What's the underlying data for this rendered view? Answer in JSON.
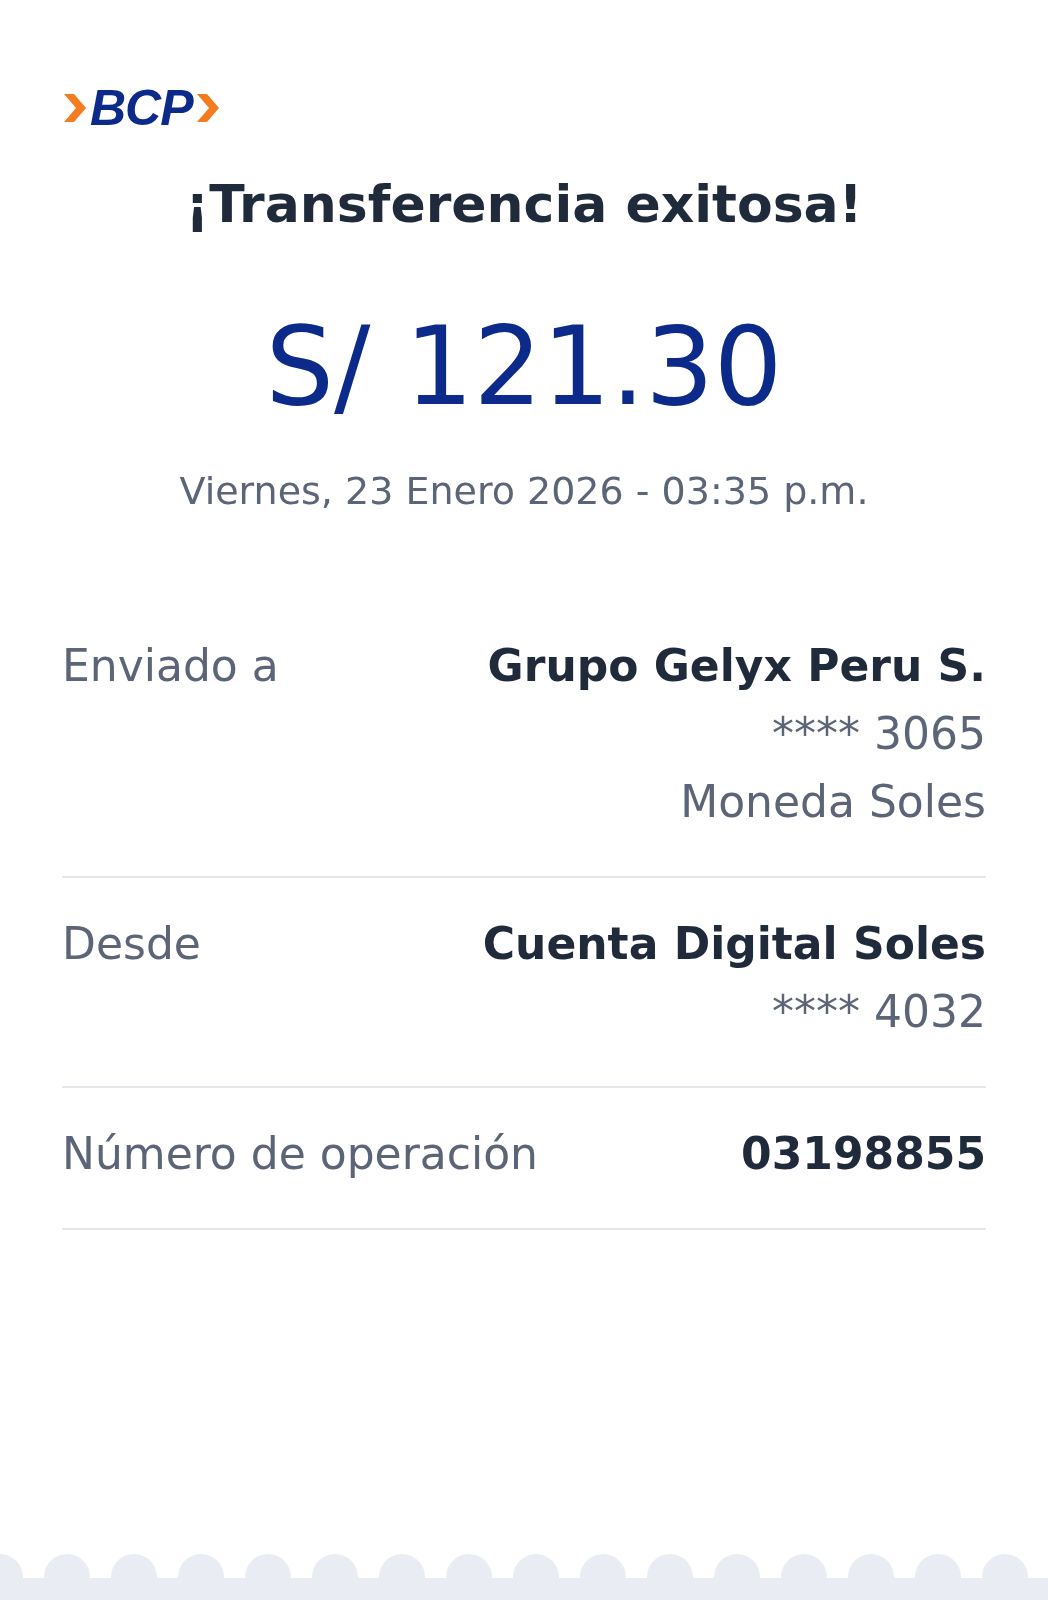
{
  "logo": {
    "text": "BCP"
  },
  "title": "¡Transferencia exitosa!",
  "amount": "S/ 121.30",
  "datetime": "Viernes, 23 Enero 2026 - 03:35 p.m.",
  "rows": [
    {
      "label": "Enviado a",
      "values": [
        {
          "kind": "main",
          "text": "Grupo Gelyx Peru S."
        },
        {
          "kind": "detail",
          "text": "**** 3065"
        },
        {
          "kind": "detail",
          "text": "Moneda Soles"
        }
      ]
    },
    {
      "label": "Desde",
      "values": [
        {
          "kind": "main",
          "text": "Cuenta Digital Soles"
        },
        {
          "kind": "detail",
          "text": "**** 4032"
        }
      ]
    },
    {
      "label": "Número de operación",
      "values": [
        {
          "kind": "main",
          "text": "03198855"
        }
      ]
    }
  ]
}
